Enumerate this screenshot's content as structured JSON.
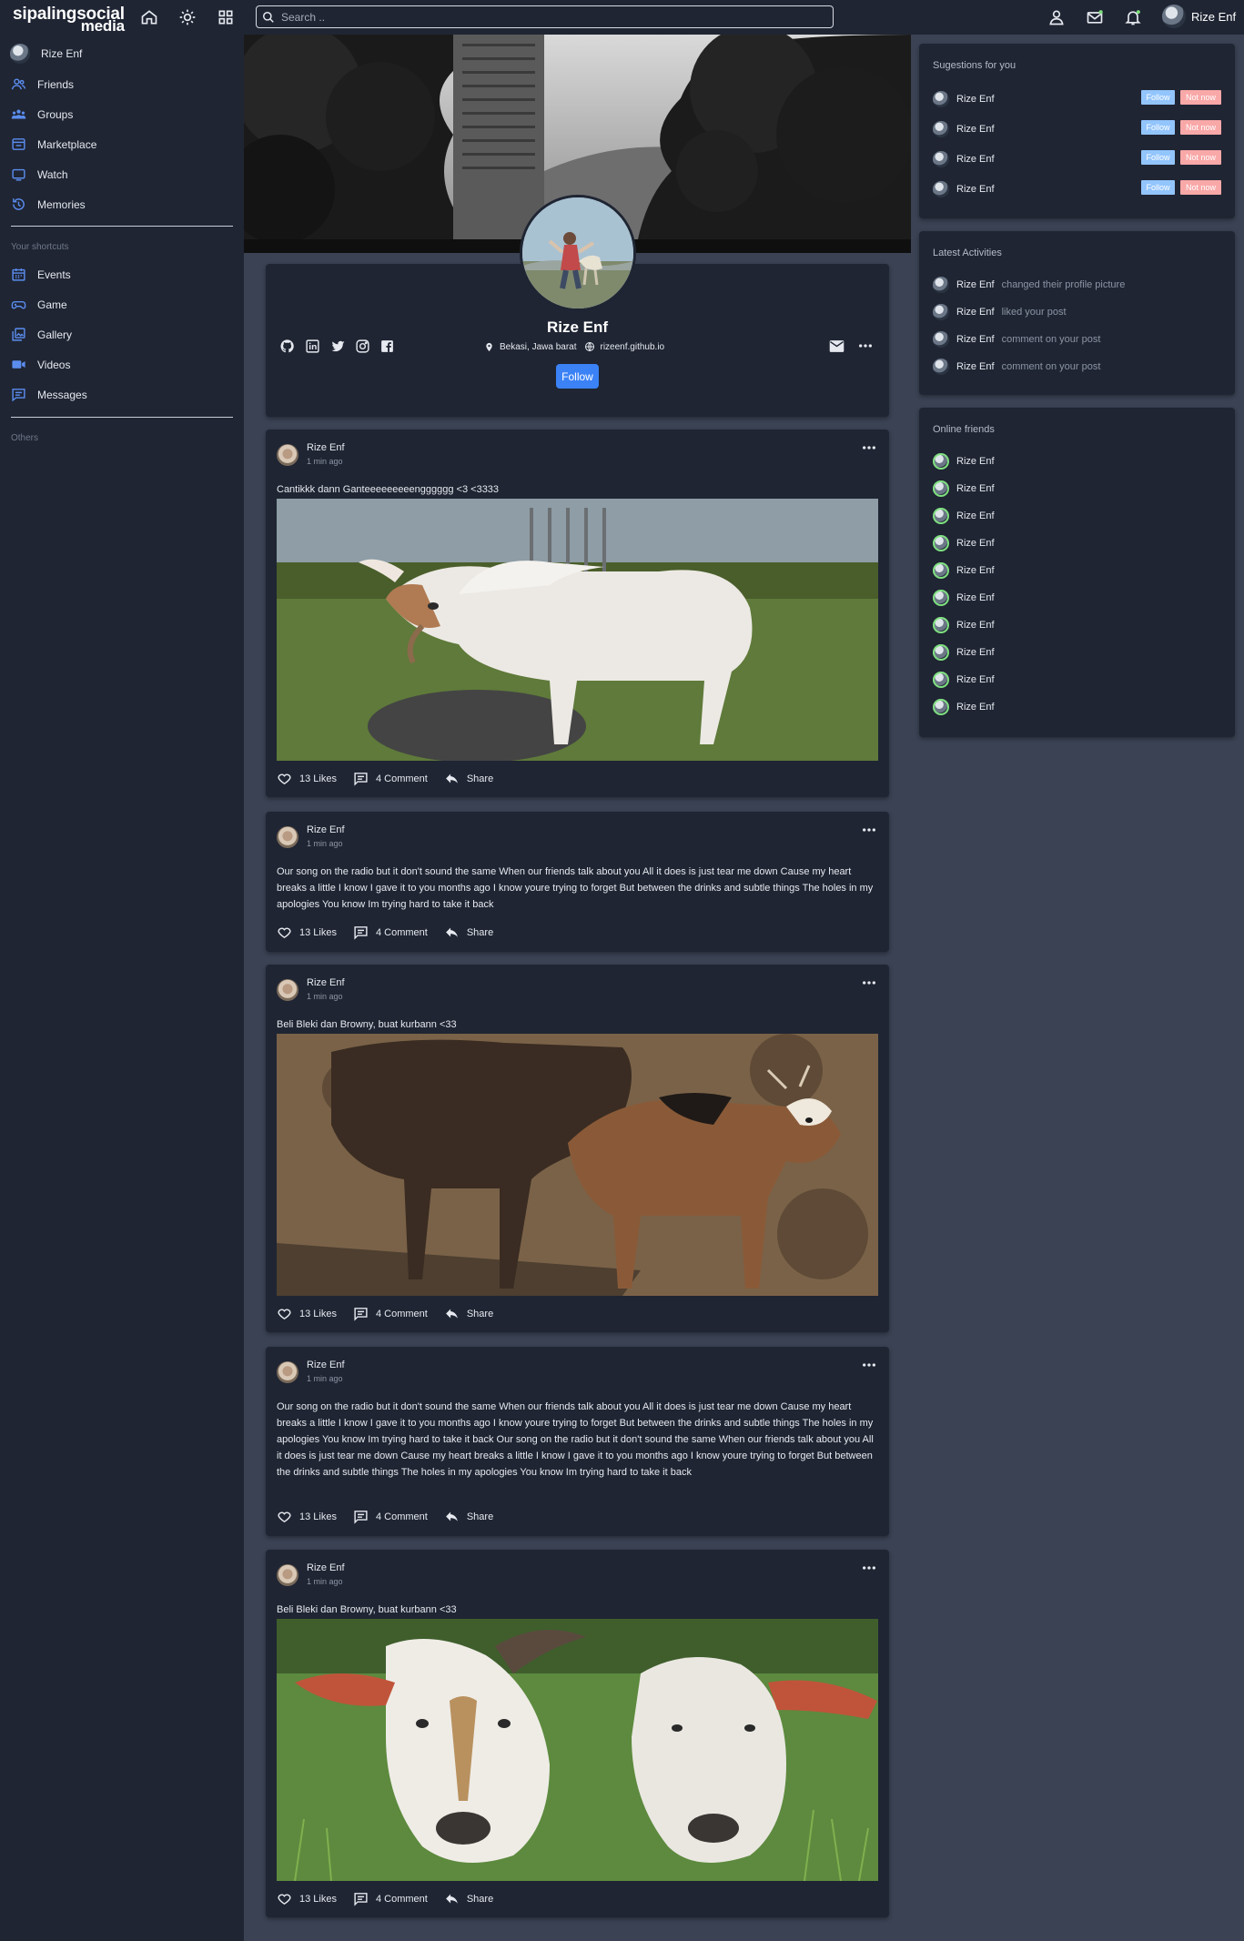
{
  "app": {
    "logo_line1": "sipalingsocial",
    "logo_line2": "media"
  },
  "topbar": {
    "search_placeholder": "Search ..",
    "user_name": "Rize Enf",
    "accent": "#3b82f6"
  },
  "sidebar": {
    "profile_name": "Rize Enf",
    "main_items": [
      {
        "label": "Friends",
        "icon": "friends-icon"
      },
      {
        "label": "Groups",
        "icon": "groups-icon"
      },
      {
        "label": "Marketplace",
        "icon": "marketplace-icon"
      },
      {
        "label": "Watch",
        "icon": "watch-icon"
      },
      {
        "label": "Memories",
        "icon": "memories-icon"
      }
    ],
    "shortcuts_heading": "Your shortcuts",
    "shortcuts": [
      {
        "label": "Events",
        "icon": "calendar-icon"
      },
      {
        "label": "Game",
        "icon": "game-icon"
      },
      {
        "label": "Gallery",
        "icon": "gallery-icon"
      },
      {
        "label": "Videos",
        "icon": "video-icon"
      },
      {
        "label": "Messages",
        "icon": "messages-icon"
      }
    ],
    "others_heading": "Others"
  },
  "profile": {
    "name": "Rize Enf",
    "location": "Bekasi, Jawa barat",
    "website": "rizeenf.github.io",
    "follow_label": "Follow"
  },
  "posts": [
    {
      "author": "Rize Enf",
      "time": "1 min ago",
      "text": "Cantikkk dann Ganteeeeeeeeengggggg <3 <3333",
      "likes": "13 Likes",
      "comments": "4 Comment",
      "share": "Share"
    },
    {
      "author": "Rize Enf",
      "time": "1 min ago",
      "text": "Our song on the radio but it don't sound the same When our friends talk about you All it does is just tear me down Cause my heart breaks a little I know I gave it to you months ago I know youre trying to forget But between the drinks and subtle things The holes in my apologies You know Im trying hard to take it back",
      "likes": "13 Likes",
      "comments": "4 Comment",
      "share": "Share"
    },
    {
      "author": "Rize Enf",
      "time": "1 min ago",
      "text": "Beli Bleki dan Browny, buat kurbann <33",
      "likes": "13 Likes",
      "comments": "4 Comment",
      "share": "Share"
    },
    {
      "author": "Rize Enf",
      "time": "1 min ago",
      "text": "Our song on the radio but it don't sound the same When our friends talk about you All it does is just tear me down Cause my heart breaks a little I know I gave it to you months ago I know youre trying to forget But between the drinks and subtle things The holes in my apologies You know Im trying hard to take it back Our song on the radio but it don't sound the same When our friends talk about you All it does is just tear me down Cause my heart breaks a little I know I gave it to you months ago I know youre trying to forget But between the drinks and subtle things The holes in my apologies You know Im trying hard to take it back",
      "likes": "13 Likes",
      "comments": "4 Comment",
      "share": "Share"
    },
    {
      "author": "Rize Enf",
      "time": "1 min ago",
      "text": "Beli Bleki dan Browny, buat kurbann <33",
      "likes": "13 Likes",
      "comments": "4 Comment",
      "share": "Share"
    }
  ],
  "suggestions": {
    "title": "Sugestions for you",
    "follow_label": "Follow",
    "notnow_label": "Not now",
    "items": [
      "Rize Enf",
      "Rize Enf",
      "Rize Enf",
      "Rize Enf"
    ]
  },
  "activities": {
    "title": "Latest Activities",
    "items": [
      {
        "name": "Rize Enf",
        "action": "changed their profile picture"
      },
      {
        "name": "Rize Enf",
        "action": "liked your post"
      },
      {
        "name": "Rize Enf",
        "action": "comment on your post"
      },
      {
        "name": "Rize Enf",
        "action": "comment on your post"
      }
    ]
  },
  "online": {
    "title": "Online friends",
    "status_color": "#7ee07e",
    "items": [
      "Rize Enf",
      "Rize Enf",
      "Rize Enf",
      "Rize Enf",
      "Rize Enf",
      "Rize Enf",
      "Rize Enf",
      "Rize Enf",
      "Rize Enf",
      "Rize Enf"
    ]
  }
}
